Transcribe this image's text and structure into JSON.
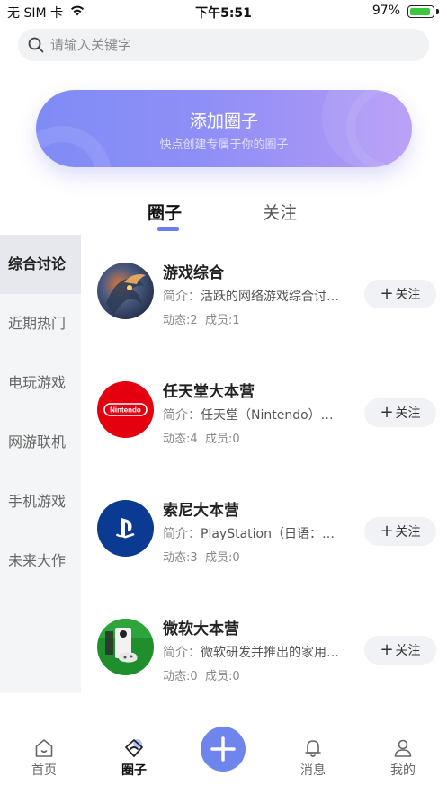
{
  "status_bar": {
    "carrier": "无 SIM 卡",
    "time": "下午5:51",
    "battery_pct": "97%",
    "battery_level": 0.97
  },
  "search": {
    "placeholder": "请输入关键字",
    "value": ""
  },
  "banner": {
    "title": "添加圈子",
    "subtitle": "快点创建专属于你的圈子"
  },
  "tabs": [
    {
      "label": "圈子",
      "active": true
    },
    {
      "label": "关注",
      "active": false
    }
  ],
  "sidebar": {
    "items": [
      {
        "label": "综合讨论",
        "active": true
      },
      {
        "label": "近期热门",
        "active": false
      },
      {
        "label": "电玩游戏",
        "active": false
      },
      {
        "label": "网游联机",
        "active": false
      },
      {
        "label": "手机游戏",
        "active": false
      },
      {
        "label": "未来大作",
        "active": false
      }
    ]
  },
  "circles": [
    {
      "name": "游戏综合",
      "desc_label": "简介：",
      "desc": "活跃的网络游戏综合讨论区",
      "stats_posts_label": "动态:",
      "posts": "2",
      "stats_members_label": "成员:",
      "members": "1",
      "follow_label": "关注",
      "avatar_icon": "dragon-art-icon"
    },
    {
      "name": "任天堂大本营",
      "desc_label": "简介：",
      "desc": "任天堂（Nintendo）是日本著名的游戏公司",
      "stats_posts_label": "动态:",
      "posts": "4",
      "stats_members_label": "成员:",
      "members": "0",
      "follow_label": "关注",
      "avatar_icon": "nintendo-logo-icon",
      "avatar_text": "Nintendo"
    },
    {
      "name": "索尼大本营",
      "desc_label": "简介：",
      "desc": "PlayStation（日语：プレイステーション）",
      "stats_posts_label": "动态:",
      "posts": "3",
      "stats_members_label": "成员:",
      "members": "0",
      "follow_label": "关注",
      "avatar_icon": "playstation-logo-icon"
    },
    {
      "name": "微软大本营",
      "desc_label": "简介：",
      "desc": "微软研发并推出的家用游戏机",
      "stats_posts_label": "动态:",
      "posts": "0",
      "stats_members_label": "成员:",
      "members": "0",
      "follow_label": "关注",
      "avatar_icon": "xbox-console-icon"
    }
  ],
  "tabbar": {
    "items": [
      {
        "label": "首页",
        "icon": "home-icon",
        "active": false
      },
      {
        "label": "圈子",
        "icon": "circle-icon",
        "active": true
      },
      {
        "label": "",
        "icon": "plus-icon",
        "active": false
      },
      {
        "label": "消息",
        "icon": "bell-icon",
        "active": false
      },
      {
        "label": "我的",
        "icon": "user-icon",
        "active": false
      }
    ]
  },
  "colors": {
    "accent": "#6f85ee",
    "banner_start": "#7f8cf6",
    "banner_end": "#b49af6"
  }
}
